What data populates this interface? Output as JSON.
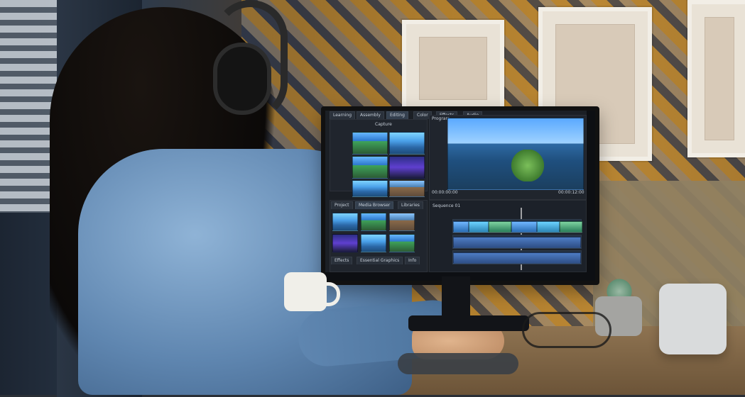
{
  "scene": {
    "screen_ui": {
      "top_tabs": [
        "Learning",
        "Assembly",
        "Editing",
        "Color",
        "Effects",
        "Audio"
      ],
      "active_top_tab": "Editing",
      "left_panel_title": "Capture",
      "media_browser_tabs": [
        "Project",
        "Media Browser",
        "Libraries"
      ],
      "bottom_left_tabs": [
        "Effects",
        "Essential Graphics",
        "Info"
      ],
      "program_label": "Program",
      "timeline_label": "Sequence 01",
      "timecode_left": "00:00:00:00",
      "timecode_right": "00:00:12:00"
    }
  }
}
